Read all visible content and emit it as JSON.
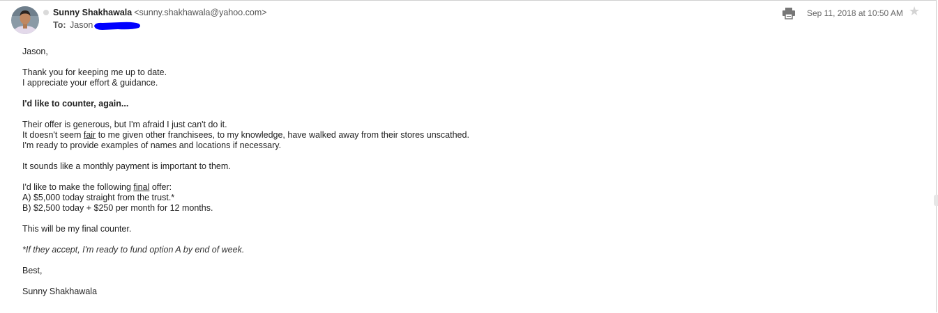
{
  "header": {
    "sender_name": "Sunny Shakhawala",
    "sender_email": "<sunny.shakhawala@yahoo.com>",
    "to_label": "To:",
    "to_name": "Jason",
    "date": "Sep 11, 2018 at 10:50 AM",
    "print_icon": "print-icon",
    "star_icon": "star-icon",
    "redaction_color": "#0000ff"
  },
  "body": {
    "greeting": "Jason,",
    "p1": {
      "line1": "Thank you for keeping me up to date.",
      "line2": "I appreciate your effort & guidance."
    },
    "counter_heading": "I'd like to counter, again...",
    "p2": {
      "line1": "Their offer is generous, but I'm afraid I just can't do it.",
      "line2_pre": "It doesn't seem ",
      "line2_fair": "fair",
      "line2_post": " to me given other franchisees, to my knowledge, have walked away from their stores unscathed.",
      "line3": "I'm ready to provide examples of names and locations if necessary."
    },
    "p3": "It sounds like a monthly payment is important to them.",
    "p4": {
      "line1_pre": "I'd like to make the following ",
      "line1_final": "final",
      "line1_post": " offer:",
      "option_a": "A) $5,000 today straight from the trust.*",
      "option_b": "B) $2,500 today + $250 per month for 12 months."
    },
    "p5": "This will be my final counter.",
    "p6": "*If they accept, I'm ready to fund option A by end of week.",
    "closing": "Best,",
    "signature": "Sunny Shakhawala"
  }
}
